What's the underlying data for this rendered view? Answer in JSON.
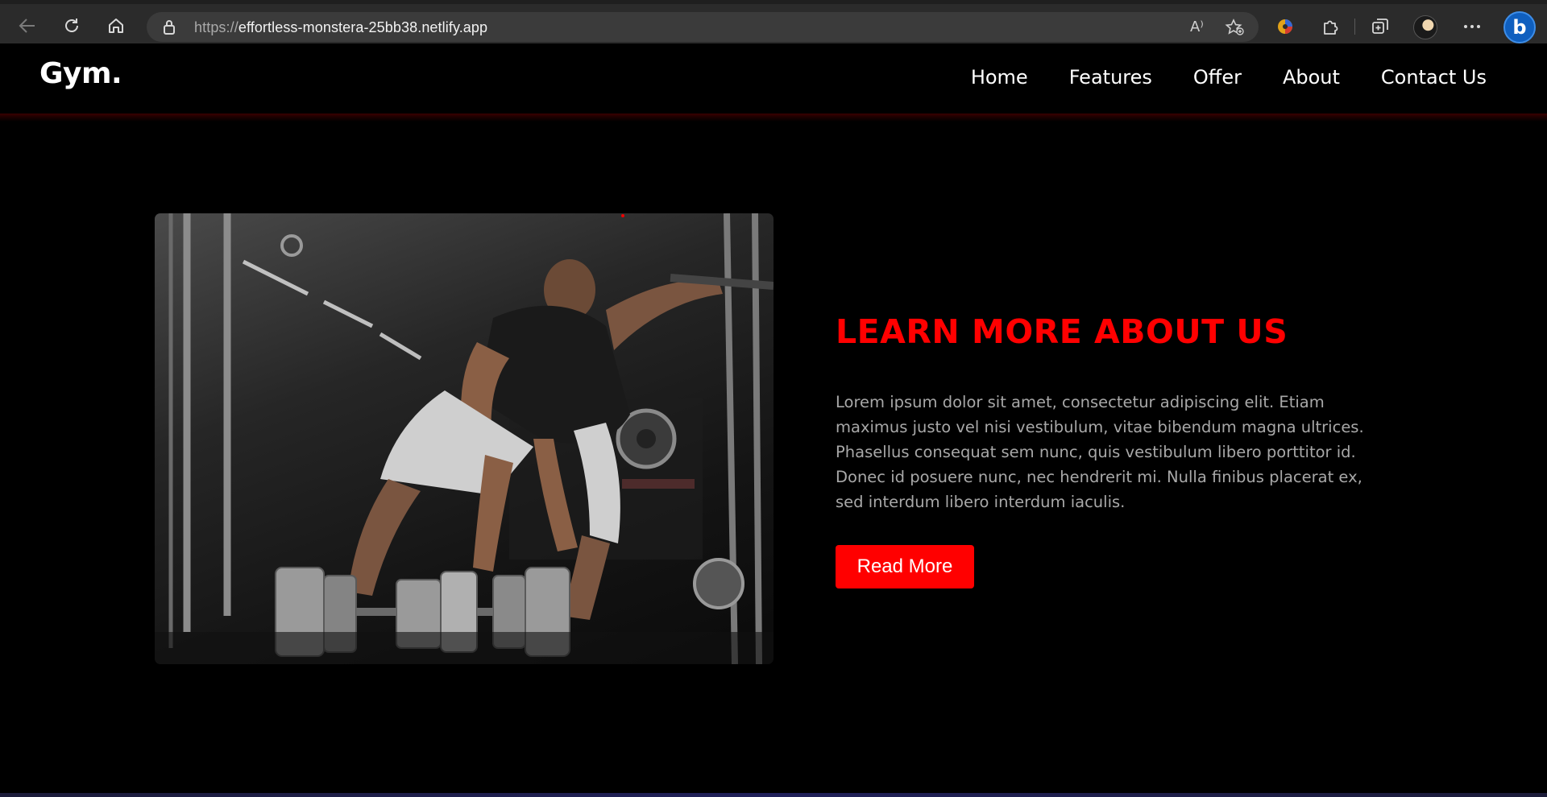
{
  "browser": {
    "url_protocol": "https://",
    "url_host": "effortless-monstera-25bb38.netlify.app",
    "read_aloud_glyph": "A⁾",
    "bing_letter": "b"
  },
  "site": {
    "logo": "Gym.",
    "nav": [
      {
        "label": "Home"
      },
      {
        "label": "Features"
      },
      {
        "label": "Offer"
      },
      {
        "label": "About"
      },
      {
        "label": "Contact Us"
      }
    ]
  },
  "about": {
    "title": "LEARN MORE ABOUT US",
    "body": "Lorem ipsum dolor sit amet, consectetur adipiscing elit. Etiam maximus justo vel nisi vestibulum, vitae bibendum magna ultrices. Phasellus consequat sem nunc, quis vestibulum libero porttitor id. Donec id posuere nunc, nec hendrerit mi. Nulla finibus placerat ex, sed interdum libero interdum iaculis.",
    "button_label": "Read More",
    "image_icon": "gym-bodybuilder-photo"
  },
  "colors": {
    "accent": "#ff0000",
    "background": "#000000",
    "body_text": "#a8a8a8"
  }
}
